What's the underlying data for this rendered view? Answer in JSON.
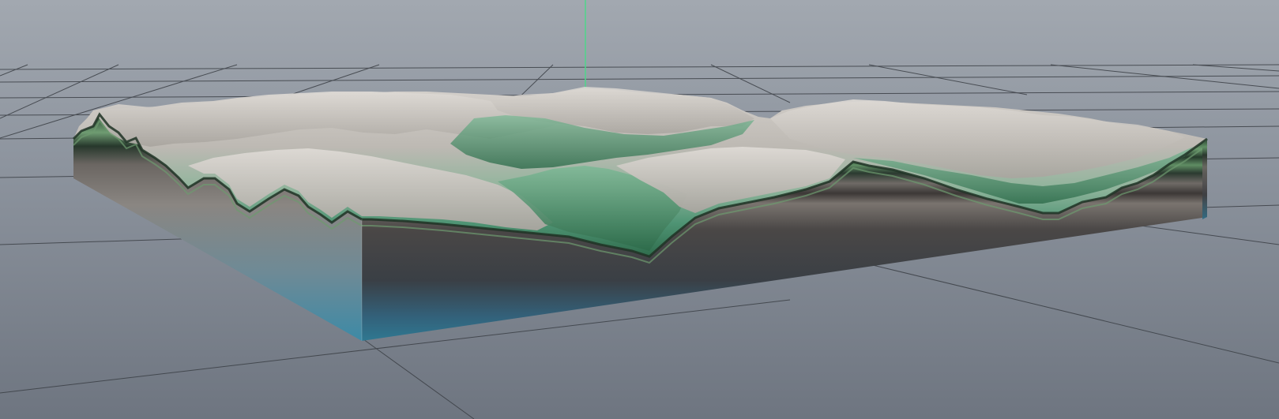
{
  "viewport": {
    "background_top": "#9ba2ab",
    "background_bottom": "#6f7782",
    "grid_line_color": "#3a3e44",
    "axis_y_color": "#4fd68a"
  },
  "terrain": {
    "snow_color": "#cfccc8",
    "rock_color": "#a7a39d",
    "vegetation_color": "#5fa27c",
    "deep_vegetation_color": "#2f6a47",
    "strata_dark_color": "#2b3b2e",
    "strata_band_color": "#4f7a55",
    "side_base_color": "#2f6f8a",
    "side_mid_color": "#3b3f43"
  }
}
